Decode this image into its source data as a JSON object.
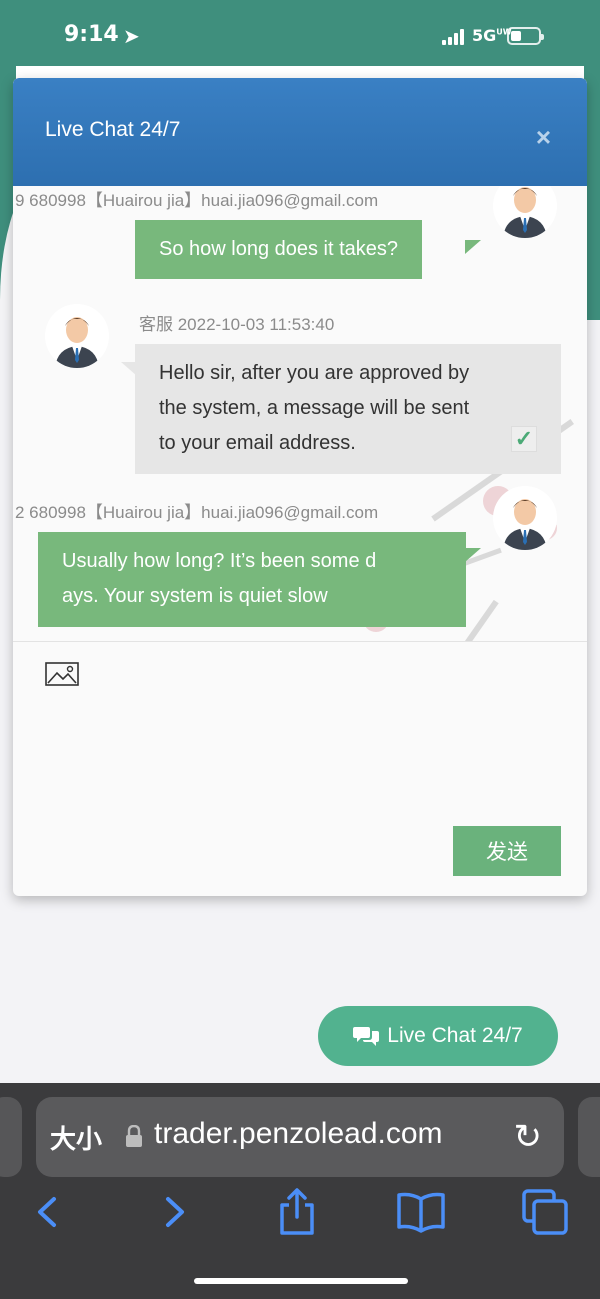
{
  "status_bar": {
    "time": "9:14",
    "network": "5G",
    "network_sup": "UW"
  },
  "dialog": {
    "title": "Live Chat 24/7",
    "close_glyph": "×",
    "messages": [
      {
        "sender": "user",
        "meta": "9    680998【Huairou jia】huai.jia096@gmail.com",
        "text": "So how long does it takes?"
      },
      {
        "sender": "agent",
        "meta": "客服    2022-10-03 11:53:40",
        "lines": [
          "Hello sir, after you are approved by",
          "the system, a message will be sent",
          "to your email address."
        ],
        "read_check": "✓"
      },
      {
        "sender": "user",
        "meta": "2    680998【Huairou jia】huai.jia096@gmail.com",
        "lines": [
          "Usually how long? It’s been some d",
          "ays. Your system is quiet slow"
        ]
      }
    ],
    "image_icon": "image-icon",
    "send_label": "发送"
  },
  "float_button": {
    "label": "Live Chat 24/7",
    "icon": "chat-bubbles-icon"
  },
  "safari": {
    "text_size": "大小",
    "url": "trader.penzolead.com"
  },
  "colors": {
    "header_blue": "#3a80c4",
    "user_bubble": "#78b87c",
    "agent_bubble": "#e6e6e6",
    "send_button": "#6ab27c",
    "float_button": "#52b28f",
    "teal_bg": "#3f8f7d",
    "safari_icons": "#4b8ef7"
  }
}
